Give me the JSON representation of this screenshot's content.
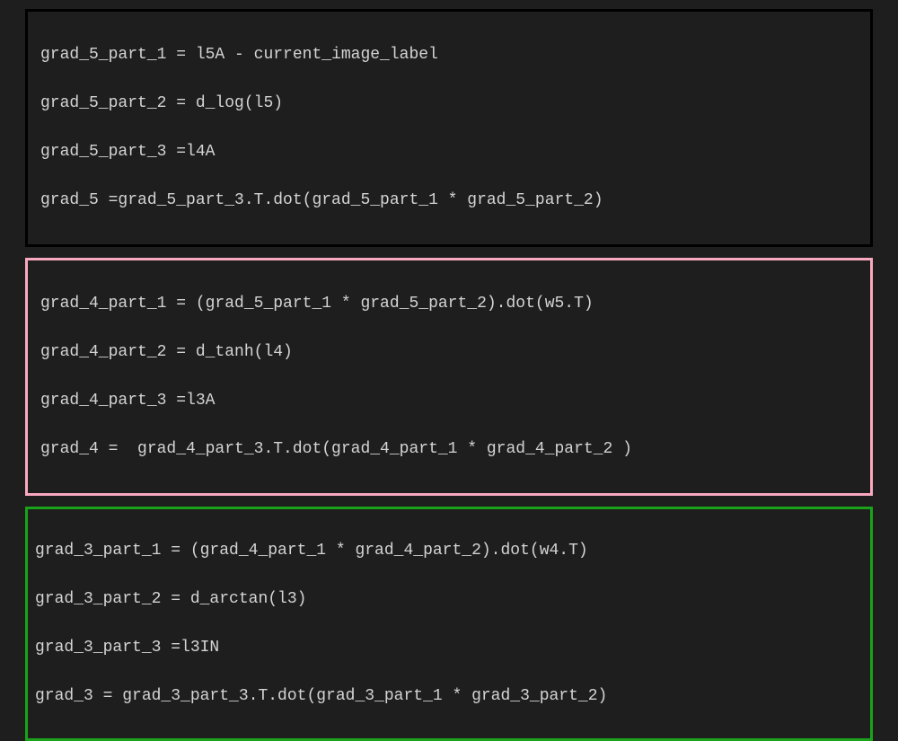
{
  "blocks": [
    {
      "colorClass": "blk-black",
      "borderColor": "#000000",
      "lines": [
        "grad_5_part_1 = l5A - current_image_label",
        "grad_5_part_2 = d_log(l5)",
        "grad_5_part_3 =l4A",
        "grad_5 =grad_5_part_3.T.dot(grad_5_part_1 * grad_5_part_2)"
      ]
    },
    {
      "colorClass": "blk-pink",
      "borderColor": "#f8a8bf",
      "lines": [
        "grad_4_part_1 = (grad_5_part_1 * grad_5_part_2).dot(w5.T)",
        "grad_4_part_2 = d_tanh(l4)",
        "grad_4_part_3 =l3A",
        "grad_4 =  grad_4_part_3.T.dot(grad_4_part_1 * grad_4_part_2 )"
      ]
    },
    {
      "colorClass": "blk-green",
      "borderColor": "#1aa31a",
      "lines": [
        "grad_3_part_1 = (grad_4_part_1 * grad_4_part_2).dot(w4.T)",
        "grad_3_part_2 = d_arctan(l3)",
        "grad_3_part_3 =l3IN",
        "grad_3 = grad_3_part_3.T.dot(grad_3_part_1 * grad_3_part_2)"
      ]
    }
  ]
}
